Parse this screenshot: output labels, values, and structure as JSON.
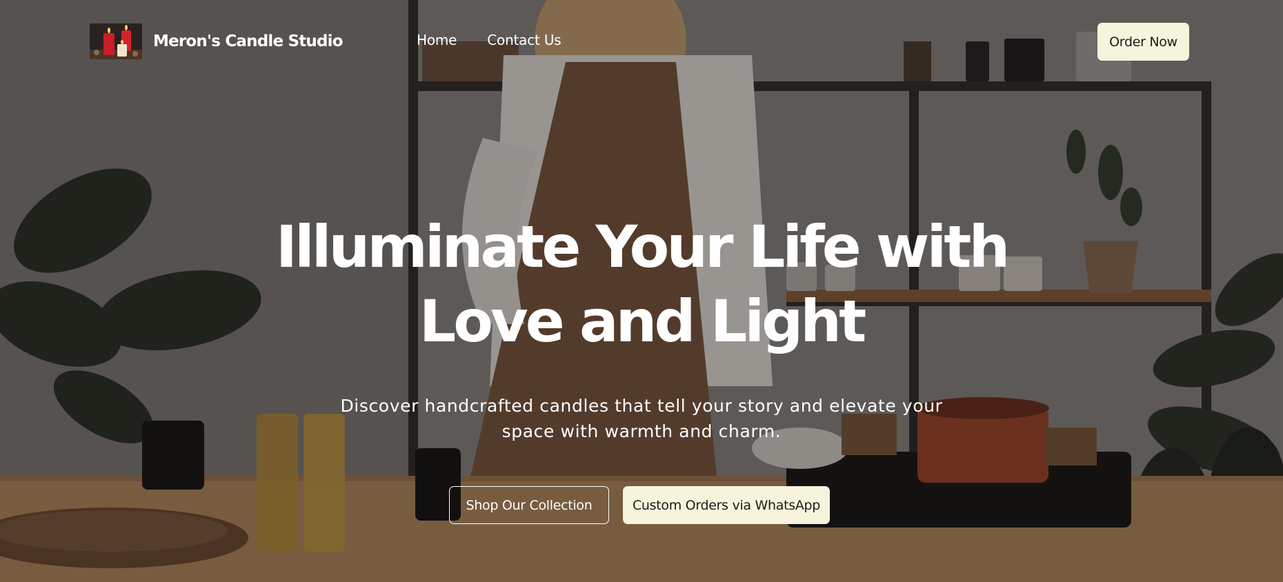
{
  "header": {
    "brand_name": "Meron's Candle Studio",
    "logo_icon": "candles-logo",
    "nav": [
      {
        "label": "Home"
      },
      {
        "label": "Contact Us"
      }
    ],
    "order_button_label": "Order Now"
  },
  "hero": {
    "title_line_1": "Illuminate Your Life with",
    "title_line_2": "Love and Light",
    "subtitle_line_1": "Discover handcrafted candles that tell your story and elevate your",
    "subtitle_line_2": "space with warmth and charm.",
    "primary_cta_label": "Shop Our Collection",
    "secondary_cta_label": "Custom Orders via WhatsApp"
  },
  "colors": {
    "button_cream": "#f6f4dc",
    "text_white": "#ffffff",
    "text_dark": "#1d1b18",
    "overlay": "rgba(20,16,14,0.38)"
  }
}
